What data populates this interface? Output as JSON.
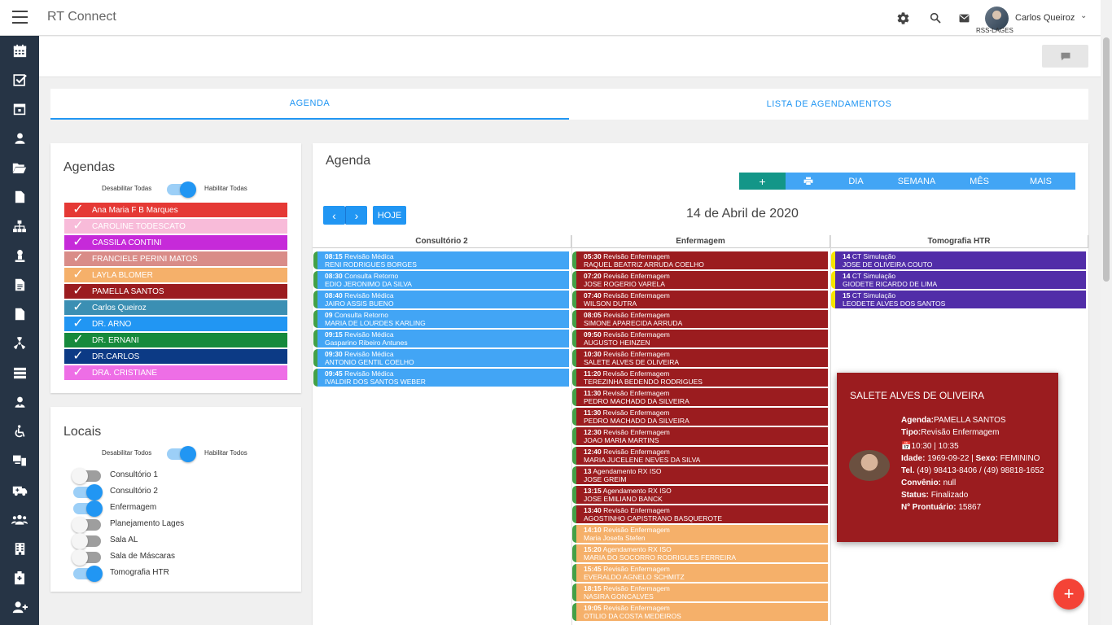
{
  "app": {
    "title": "RT Connect"
  },
  "user": {
    "name": "Carlos Queiroz",
    "unit": "RSS-LAGES"
  },
  "icons": {
    "settings": "gear-icon",
    "search": "search-icon",
    "mail": "mail-icon",
    "chat": "chat-icon"
  },
  "tabs": [
    {
      "label": "AGENDA",
      "active": true
    },
    {
      "label": "LISTA DE AGENDAMENTOS",
      "active": false
    }
  ],
  "agendas_panel": {
    "title": "Agendas",
    "disable_all": "Desabilitar Todas",
    "enable_all": "Habilitar Todas",
    "items": [
      {
        "label": "Ana Maria F B Marques",
        "color": "#e53935"
      },
      {
        "label": "CAROLINE TODESCATO",
        "color": "#f8bbd9"
      },
      {
        "label": "CASSILA CONTINI",
        "color": "#c62ad9"
      },
      {
        "label": "FRANCIELE PERINI MATOS",
        "color": "#d98c88"
      },
      {
        "label": "LAYLA BLOMER",
        "color": "#f5b06a"
      },
      {
        "label": "PAMELLA SANTOS",
        "color": "#9b1c1f"
      },
      {
        "label": "Carlos Queiroz",
        "color": "#3b8fb3"
      },
      {
        "label": "DR. ARNO",
        "color": "#2196f3"
      },
      {
        "label": "DR. ERNANI",
        "color": "#168a3c"
      },
      {
        "label": "DR.CARLOS",
        "color": "#0c3a85"
      },
      {
        "label": "DRA. CRISTIANE",
        "color": "#ee6ee6"
      }
    ]
  },
  "locais_panel": {
    "title": "Locais",
    "disable_all": "Desabilitar Todos",
    "enable_all": "Habilitar Todos",
    "items": [
      {
        "label": "Consultório 1",
        "on": false
      },
      {
        "label": "Consultório 2",
        "on": true
      },
      {
        "label": "Enfermagem",
        "on": true
      },
      {
        "label": "Planejamento Lages",
        "on": false
      },
      {
        "label": "Sala AL",
        "on": false
      },
      {
        "label": "Sala de Máscaras",
        "on": false
      },
      {
        "label": "Tomografia HTR",
        "on": true
      }
    ]
  },
  "agenda": {
    "title": "Agenda",
    "toolbar": {
      "add": "+",
      "print": "print-icon",
      "day": "DIA",
      "week": "SEMANA",
      "month": "MÊS",
      "more": "MAIS"
    },
    "nav": {
      "prev": "‹",
      "next": "›",
      "today": "HOJE"
    },
    "date": "14 de Abril de 2020",
    "columns": [
      {
        "name": "Consultório 2",
        "events": [
          {
            "time": "08:15",
            "type": "Revisão Médica",
            "patient": "RENI RODRIGUES BORGES",
            "color": "#42a5f5"
          },
          {
            "time": "08:30",
            "type": "Consulta Retorno",
            "patient": "EDIO JERONIMO DA SILVA",
            "color": "#42a5f5"
          },
          {
            "time": "08:40",
            "type": "Revisão Médica",
            "patient": "JAIRO ASSIS BUENO",
            "color": "#42a5f5"
          },
          {
            "time": "09",
            "type": "Consulta Retorno",
            "patient": "MARIA DE LOURDES KARLING",
            "color": "#42a5f5"
          },
          {
            "time": "09:15",
            "type": "Revisão Médica",
            "patient": "Gasparino Ribeiro Antunes",
            "color": "#42a5f5"
          },
          {
            "time": "09:30",
            "type": "Revisão Médica",
            "patient": "ANTONIO GENTIL COELHO",
            "color": "#42a5f5"
          },
          {
            "time": "09:45",
            "type": "Revisão Médica",
            "patient": "IVALDIR DOS SANTOS WEBER",
            "color": "#42a5f5"
          }
        ]
      },
      {
        "name": "Enfermagem",
        "events": [
          {
            "time": "05:30",
            "type": "Revisão Enfermagem",
            "patient": "RAQUEL BEATRIZ ARRUDA COELHO",
            "color": "#9b1c1f"
          },
          {
            "time": "07:20",
            "type": "Revisão Enfermagem",
            "patient": "JOSE ROGERIO VARELA",
            "color": "#9b1c1f"
          },
          {
            "time": "07:40",
            "type": "Revisão Enfermagem",
            "patient": "WILSON DUTRA",
            "color": "#9b1c1f"
          },
          {
            "time": "08:05",
            "type": "Revisão Enfermagem",
            "patient": "SIMONE APARECIDA ARRUDA",
            "color": "#9b1c1f"
          },
          {
            "time": "09:50",
            "type": "Revisão Enfermagem",
            "patient": "AUGUSTO HEINZEN",
            "color": "#9b1c1f"
          },
          {
            "time": "10:30",
            "type": "Revisão Enfermagem",
            "patient": "SALETE ALVES DE OLIVEIRA",
            "color": "#9b1c1f"
          },
          {
            "time": "11:20",
            "type": "Revisão Enfermagem",
            "patient": "TEREZINHA BEDENDO RODRIGUES",
            "color": "#9b1c1f"
          },
          {
            "time": "11:30",
            "type": "Revisão Enfermagem",
            "patient": "PEDRO MACHADO DA SILVEIRA",
            "color": "#9b1c1f"
          },
          {
            "time": "11:30",
            "type": "Revisão Enfermagem",
            "patient": "PEDRO MACHADO DA SILVEIRA",
            "color": "#9b1c1f"
          },
          {
            "time": "12:30",
            "type": "Revisão Enfermagem",
            "patient": "JOAO MARIA MARTINS",
            "color": "#9b1c1f"
          },
          {
            "time": "12:40",
            "type": "Revisão Enfermagem",
            "patient": "MARIA JUCELENE NEVES DA SILVA",
            "color": "#9b1c1f"
          },
          {
            "time": "13",
            "type": "Agendamento RX ISO",
            "patient": "JOSE GREIM",
            "color": "#9b1c1f"
          },
          {
            "time": "13:15",
            "type": "Agendamento RX ISO",
            "patient": "JOSE EMILIANO BANCK",
            "color": "#9b1c1f"
          },
          {
            "time": "13:40",
            "type": "Revisão Enfermagem",
            "patient": "AGOSTINHO CAPISTRANO BASQUEROTE",
            "color": "#9b1c1f"
          },
          {
            "time": "14:10",
            "type": "Revisão Enfermagem",
            "patient": "Maria Josefa Stefen",
            "color": "#f5b06a"
          },
          {
            "time": "15:20",
            "type": "Agendamento RX ISO",
            "patient": "MARIA DO SOCORRO RODRIGUES FERREIRA",
            "color": "#f5b06a"
          },
          {
            "time": "15:45",
            "type": "Revisão Enfermagem",
            "patient": "EVERALDO AGNELO SCHMITZ",
            "color": "#f5b06a"
          },
          {
            "time": "18:15",
            "type": "Revisão Enfermagem",
            "patient": "NASIRA GONCALVES",
            "color": "#f5b06a"
          },
          {
            "time": "19:05",
            "type": "Revisão Enfermagem",
            "patient": "OTILIO DA COSTA MEDEIROS",
            "color": "#f5b06a"
          }
        ]
      },
      {
        "name": "Tomografia HTR",
        "events": [
          {
            "time": "14",
            "type": "CT Simulação",
            "patient": "JOSE DE OLIVEIRA COUTO",
            "color": "#512da8"
          },
          {
            "time": "14",
            "type": "CT Simulação",
            "patient": "GIODETE RICARDO DE LIMA",
            "color": "#512da8"
          },
          {
            "time": "15",
            "type": "CT Simulação",
            "patient": "LEODETE ALVES DOS SANTOS",
            "color": "#512da8"
          }
        ]
      }
    ]
  },
  "popup": {
    "name": "SALETE ALVES DE OLIVEIRA",
    "agenda_label": "Agenda:",
    "agenda": "PAMELLA SANTOS",
    "tipo_label": "Tipo:",
    "tipo": "Revisão Enfermagem",
    "time": "10:30 | 10:35",
    "idade_label": "Idade:",
    "idade": "1969-09-22",
    "sexo_label": "Sexo:",
    "sexo": "FEMININO",
    "tel_label": "Tel.",
    "tel": "(49) 98413-8406 / (49) 98818-1652",
    "convenio_label": "Convênio:",
    "convenio": "null",
    "status_label": "Status:",
    "status": "Finalizado",
    "prontuario_label": "Nº Prontuário:",
    "prontuario": "15867"
  },
  "fab": {
    "label": "+"
  }
}
